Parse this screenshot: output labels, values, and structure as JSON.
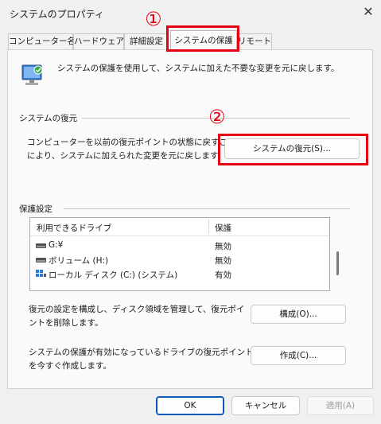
{
  "window": {
    "title": "システムのプロパティ",
    "close_glyph": "✕"
  },
  "tabs": [
    {
      "label": "コンピューター名"
    },
    {
      "label": "ハードウェア"
    },
    {
      "label": "詳細設定"
    },
    {
      "label": "システムの保護"
    },
    {
      "label": "リモート"
    }
  ],
  "annotations": {
    "marker1": "①",
    "marker2": "②",
    "color": "#e60012"
  },
  "intro_text": "システムの保護を使用して、システムに加えた不要な変更を元に戻します。",
  "restore_section": {
    "title": "システムの復元",
    "desc_line1": "コンピューターを以前の復元ポイントの状態に戻すこと",
    "desc_line2": "により、システムに加えられた変更を元に戻します。",
    "button_label": "システムの復元(S)..."
  },
  "protection_section": {
    "title": "保護設定",
    "columns": [
      "利用できるドライブ",
      "保護"
    ],
    "drives": [
      {
        "name": "G:¥",
        "status": "無効",
        "icon": "drive-icon"
      },
      {
        "name": "ボリューム (H:)",
        "status": "無効",
        "icon": "drive-icon"
      },
      {
        "name": "ローカル ディスク (C:) (システム)",
        "status": "有効",
        "icon": "system-drive-icon"
      }
    ],
    "configure_desc_line1": "復元の設定を構成し、ディスク領域を管理して、復元ポイ",
    "configure_desc_line2": "ントを削除します。",
    "configure_button": "構成(O)...",
    "create_desc_line1": "システムの保護が有効になっているドライブの復元ポイント",
    "create_desc_line2": "を今すぐ作成します。",
    "create_button": "作成(C)..."
  },
  "footer": {
    "ok": "OK",
    "cancel": "キャンセル",
    "apply": "適用(A)"
  },
  "colors": {
    "accent": "#0a58b8",
    "annotation": "#e60012",
    "dialog_bg": "#f0f0f0"
  }
}
